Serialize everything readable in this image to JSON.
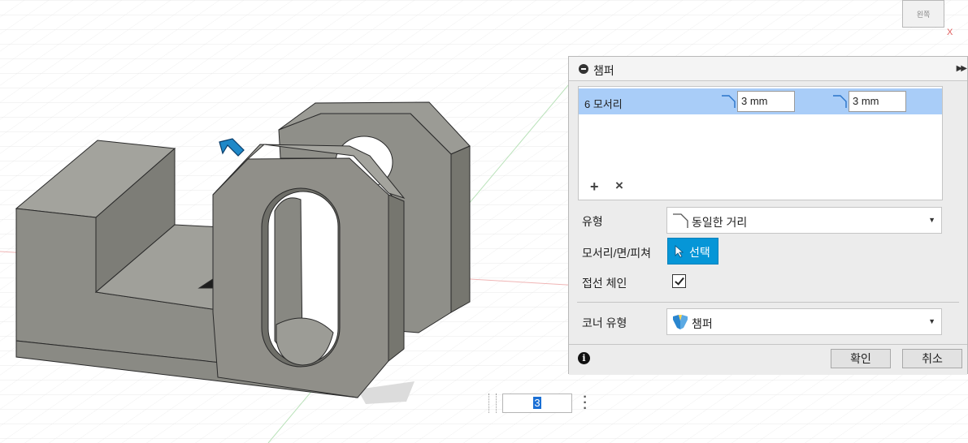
{
  "viewcube": {
    "label": "왼쪽",
    "axis_label": "X"
  },
  "panel": {
    "title": "챔퍼",
    "edge_row": {
      "label": "6 모서리",
      "distance_1": "3 mm",
      "distance_2": "3 mm"
    },
    "type": {
      "label": "유형",
      "value": "동일한 거리"
    },
    "edges_faces": {
      "label": "모서리/면/피쳐",
      "button": "선택"
    },
    "tangent_chain": {
      "label": "접선 체인",
      "checked": true
    },
    "corner_type": {
      "label": "코너 유형",
      "value": "챔퍼"
    },
    "footer": {
      "ok": "확인",
      "cancel": "취소"
    }
  },
  "float_input": {
    "value": "3"
  },
  "colors": {
    "accent": "#0696d7",
    "selection_row": "#a9cdf8",
    "model_face": "#8f8f88"
  },
  "icons": [
    "collapse-icon",
    "expand-icon",
    "chamfer-distance-icon",
    "add-icon",
    "remove-icon",
    "cursor-icon",
    "corner-chamfer-icon",
    "info-icon",
    "more-icon",
    "direction-arrow-icon"
  ]
}
